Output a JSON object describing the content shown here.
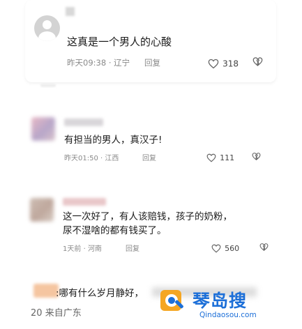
{
  "comments": [
    {
      "text": "这真是一个男人的心酸",
      "time": "昨天09:38",
      "location": "辽宁",
      "reply": "回复",
      "likes": "318"
    },
    {
      "text": "有担当的男人，真汉子!",
      "time": "昨天01:50",
      "location": "江西",
      "reply": "回复",
      "likes": "111"
    },
    {
      "text_line1": "这一次好了，有人该赔钱，孩子的奶粉，",
      "text_line2": "尿不湿啥的都有钱买了。",
      "time": "1天前",
      "location": "河南",
      "reply": "回复",
      "likes": "560"
    },
    {
      "text_partial": ":哪有什么岁月静好，",
      "time_partial": "20",
      "location_partial": "来自广东"
    }
  ],
  "separator": "·",
  "watermark": {
    "brand": "琴岛搜",
    "url": "Qindaosou.com"
  },
  "colors": {
    "meta": "#8a8a8a",
    "brand": "#1c6fd8",
    "brand_orange": "#f5a623"
  },
  "icons": [
    "heart-outline-icon",
    "broken-heart-icon"
  ]
}
